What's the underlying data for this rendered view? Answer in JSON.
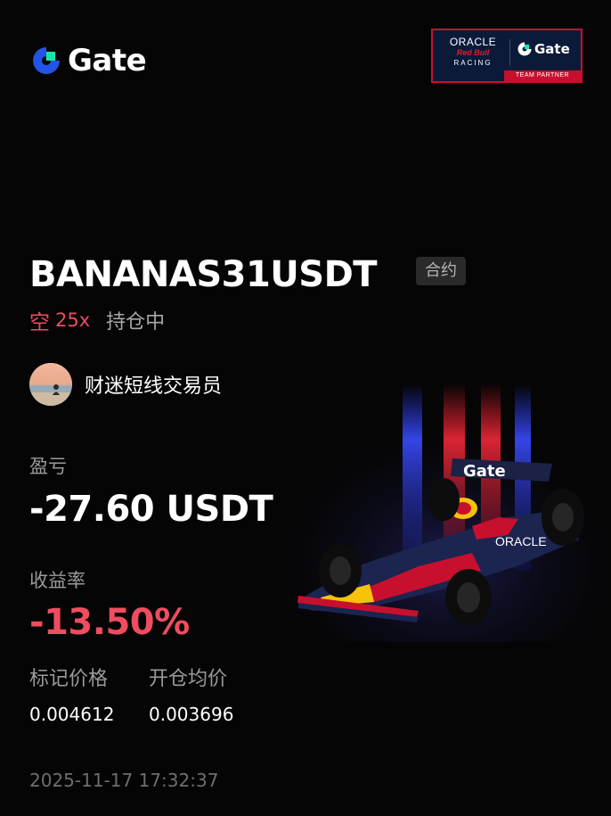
{
  "brand": {
    "name": "Gate",
    "accent_color": "#17e5a8",
    "icon": "gate-logo-icon"
  },
  "partner_badge": {
    "oracle": "ORACLE",
    "red_bull": "Red Bull",
    "racing": "RACING",
    "gate": "Gate",
    "team_partner": "TEAM PARTNER",
    "border_color": "#c8102e"
  },
  "position": {
    "symbol": "BANANAS31USDT",
    "contract_type": "合约",
    "side": "空",
    "leverage": "25x",
    "status": "持仓中",
    "side_color": "#ef4d5f"
  },
  "trader": {
    "name": "财迷短线交易员",
    "avatar_icon": "trader-avatar"
  },
  "pnl": {
    "label": "盈亏",
    "value": "-27.60 USDT"
  },
  "roi": {
    "label": "收益率",
    "value": "-13.50%",
    "color": "#ef4d5f"
  },
  "prices": {
    "mark_label": "标记价格",
    "entry_label": "开仓均价",
    "mark_value": "0.004612",
    "entry_value": "0.003696"
  },
  "timestamp": "2025-11-17 17:32:37",
  "artwork": {
    "icon": "red-bull-f1-car-image",
    "car_wing_text": "Gate",
    "car_side_text": "ORACLE"
  }
}
